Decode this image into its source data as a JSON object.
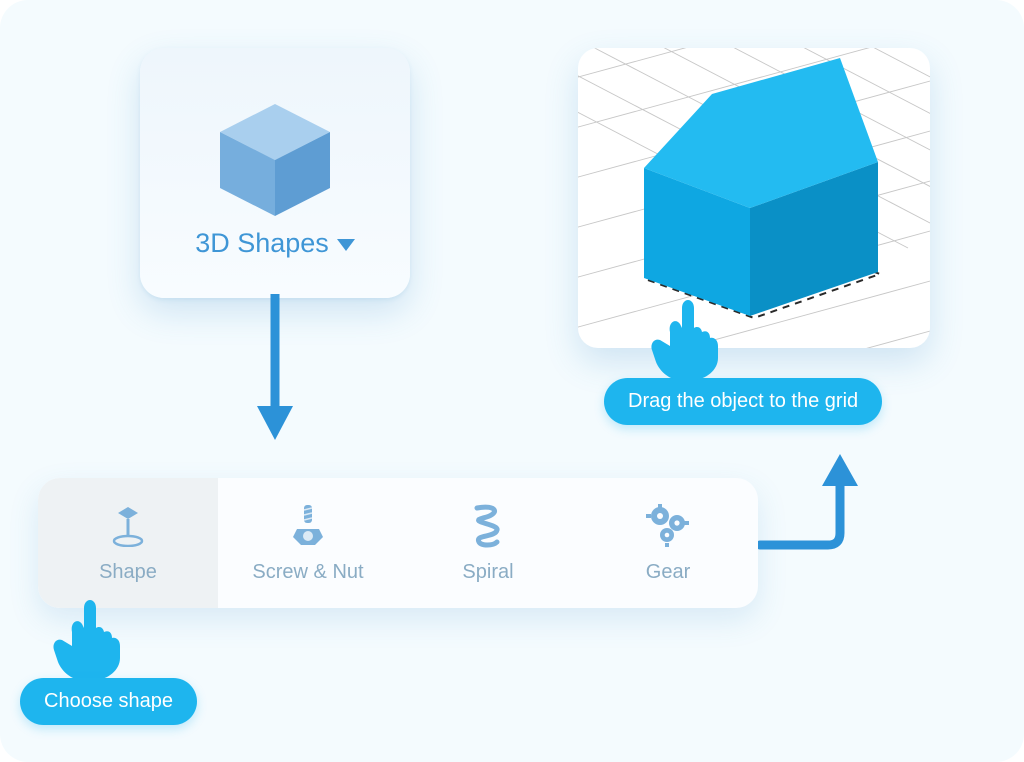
{
  "card": {
    "label": "3D Shapes"
  },
  "tooltips": {
    "drag": "Drag the object to the grid",
    "choose": "Choose shape"
  },
  "palette": {
    "items": [
      {
        "label": "Shape"
      },
      {
        "label": "Screw & Nut"
      },
      {
        "label": "Spiral"
      },
      {
        "label": "Gear"
      }
    ]
  },
  "colors": {
    "accent": "#1eb5ee",
    "muted_text": "#8aacc4",
    "card_text": "#3f96d6",
    "arrow": "#2c92d8"
  }
}
